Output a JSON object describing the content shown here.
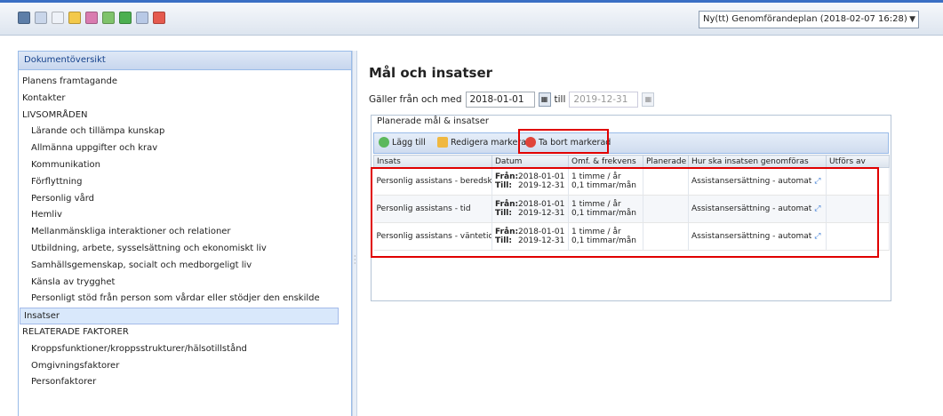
{
  "toolbar": {
    "icons": [
      "save-icon",
      "edit-icon",
      "page-icon",
      "folder-icon",
      "print-icon",
      "expand-icon",
      "refresh-icon",
      "filter-icon",
      "calendar-icon"
    ],
    "plan_select_value": "Ny(tt) Genomförandeplan (2018-02-07 16:28)"
  },
  "sidebar": {
    "header": "Dokumentöversikt",
    "items": [
      {
        "label": "Planens framtagande",
        "indent": false,
        "selected": false
      },
      {
        "label": "Kontakter",
        "indent": false,
        "selected": false
      },
      {
        "label": "LIVSOMRÅDEN",
        "indent": false,
        "selected": false
      },
      {
        "label": "Lärande och tillämpa kunskap",
        "indent": true,
        "selected": false
      },
      {
        "label": "Allmänna uppgifter och krav",
        "indent": true,
        "selected": false
      },
      {
        "label": "Kommunikation",
        "indent": true,
        "selected": false
      },
      {
        "label": "Förflyttning",
        "indent": true,
        "selected": false
      },
      {
        "label": "Personlig vård",
        "indent": true,
        "selected": false
      },
      {
        "label": "Hemliv",
        "indent": true,
        "selected": false
      },
      {
        "label": "Mellanmänskliga interaktioner och relationer",
        "indent": true,
        "selected": false
      },
      {
        "label": "Utbildning, arbete, sysselsättning och ekonomiskt liv",
        "indent": true,
        "selected": false
      },
      {
        "label": "Samhällsgemenskap, socialt och medborgeligt liv",
        "indent": true,
        "selected": false
      },
      {
        "label": "Känsla av trygghet",
        "indent": true,
        "selected": false
      },
      {
        "label": "Personligt stöd från person som vårdar eller stödjer den enskilde",
        "indent": true,
        "selected": false
      },
      {
        "label": "Insatser",
        "indent": false,
        "selected": true
      },
      {
        "label": "RELATERADE FAKTORER",
        "indent": false,
        "selected": false
      },
      {
        "label": "Kroppsfunktioner/kroppsstrukturer/hälsotillstånd",
        "indent": true,
        "selected": false
      },
      {
        "label": "Omgivningsfaktorer",
        "indent": true,
        "selected": false
      },
      {
        "label": "Personfaktorer",
        "indent": true,
        "selected": false
      }
    ]
  },
  "main": {
    "title": "Mål och insatser",
    "dates": {
      "from_label": "Gäller från och med",
      "from_value": "2018-01-01",
      "to_label": "till",
      "to_value": "2019-12-31"
    },
    "section_title": "Planerade mål & insatser",
    "buttons": {
      "add": "Lägg till",
      "edit": "Redigera markerad",
      "delete": "Ta bort markerad"
    },
    "columns": [
      "Insats",
      "Datum",
      "Omf. & frekvens",
      "Planerade",
      "Hur ska insatsen genomföras",
      "Utförs av"
    ],
    "rows": [
      {
        "insats": "Personlig assistans - beredskap",
        "from_label": "Från:",
        "from": "2018-01-01",
        "to_label": "Till:",
        "to": "2019-12-31",
        "freq1": "1 timme / år",
        "freq2": "0,1 timmar/mån",
        "planerade": "",
        "hur": "Assistansersättning - automat",
        "utfors": ""
      },
      {
        "insats": "Personlig assistans - tid",
        "from_label": "Från:",
        "from": "2018-01-01",
        "to_label": "Till:",
        "to": "2019-12-31",
        "freq1": "1 timme / år",
        "freq2": "0,1 timmar/mån",
        "planerade": "",
        "hur": "Assistansersättning - automat",
        "utfors": ""
      },
      {
        "insats": "Personlig assistans - väntetid",
        "from_label": "Från:",
        "from": "2018-01-01",
        "to_label": "Till:",
        "to": "2019-12-31",
        "freq1": "1 timme / år",
        "freq2": "0,1 timmar/mån",
        "planerade": "",
        "hur": "Assistansersättning - automat",
        "utfors": ""
      }
    ]
  },
  "colors": {
    "accent": "#3a6fc4",
    "highlight": "#e00000",
    "selected_bg": "#d9e8fb"
  }
}
